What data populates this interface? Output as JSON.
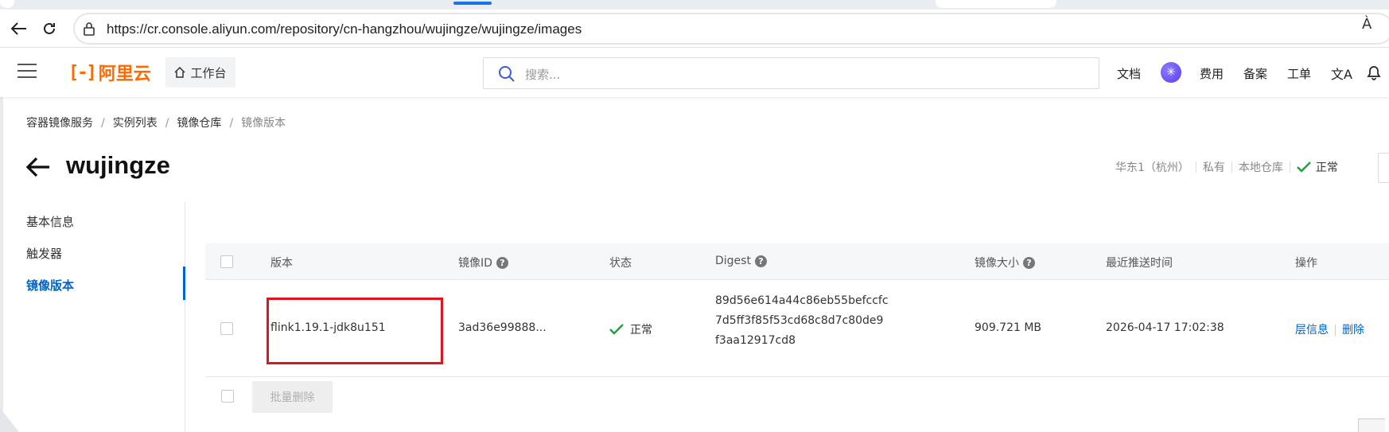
{
  "browser": {
    "url": "https://cr.console.aliyun.com/repository/cn-hangzhou/wujingze/wujingze/images",
    "read_aloud_label": "À"
  },
  "header": {
    "logo_text": "阿里云",
    "workbench_label": "工作台",
    "search_placeholder": "搜索...",
    "links": {
      "docs": "文档",
      "billing": "费用",
      "icp": "备案",
      "tickets": "工单"
    }
  },
  "breadcrumb": {
    "items": [
      "容器镜像服务",
      "实例列表",
      "镜像仓库"
    ],
    "current": "镜像版本"
  },
  "page": {
    "title": "wujingze",
    "meta": {
      "region": "华东1（杭州）",
      "visibility": "私有",
      "repo_type": "本地仓库",
      "status": "正常"
    }
  },
  "sidenav": {
    "items": [
      "基本信息",
      "触发器",
      "镜像版本"
    ],
    "active_index": 2
  },
  "table": {
    "columns": {
      "version": "版本",
      "image_id": "镜像ID",
      "status": "状态",
      "digest": "Digest",
      "size": "镜像大小",
      "pushed": "最近推送时间",
      "actions": "操作"
    },
    "rows": [
      {
        "version": "flink1.19.1-jdk8u151",
        "image_id": "3ad36e99888...",
        "status": "正常",
        "digest_lines": [
          "89d56e614a44c86eb55befccfc",
          "7d5ff3f85f53cd68c8d7c80de9",
          "f3aa12917cd8"
        ],
        "size": "909.721 MB",
        "pushed": "2026-04-17 17:02:38",
        "action_layer": "层信息",
        "action_delete": "删除"
      }
    ],
    "batch_delete_label": "批量删除"
  },
  "colors": {
    "brand": "#ff6a00",
    "link": "#0064c8",
    "success": "#1aa33a",
    "highlight": "#e0141e"
  }
}
